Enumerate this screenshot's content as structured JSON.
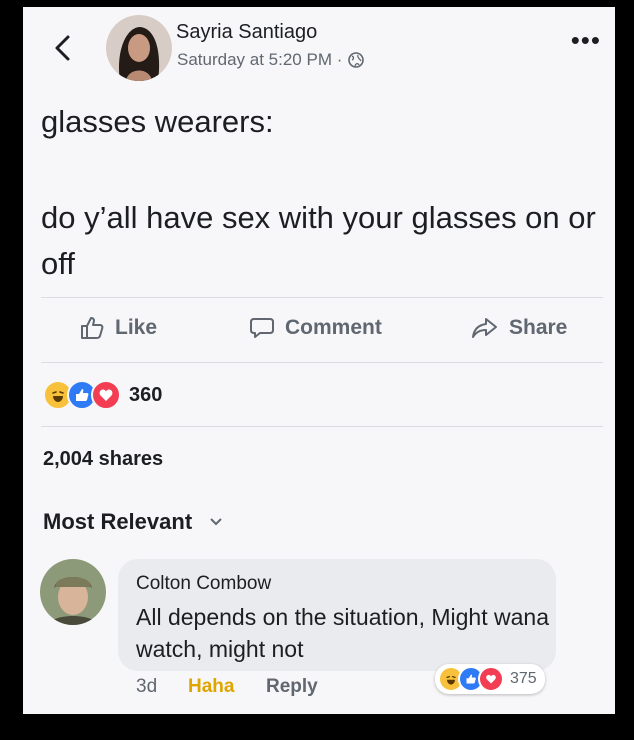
{
  "post": {
    "author": "Sayria Santiago",
    "timestamp": "Saturday at 5:20 PM ·",
    "text_line1": "glasses wearers:",
    "text_line2": "do y’all have sex with your glasses on or off"
  },
  "actions": {
    "like": "Like",
    "comment": "Comment",
    "share": "Share"
  },
  "reactions": {
    "count": "360",
    "types": [
      "haha-icon",
      "like-icon",
      "love-icon"
    ]
  },
  "shares": "2,004 shares",
  "sort": {
    "label": "Most Relevant"
  },
  "comment": {
    "author": "Colton Combow",
    "text": "All depends on the situation, Might wana watch, might not",
    "age": "3d",
    "reaction_label": "Haha",
    "reply_label": "Reply",
    "reaction_count": "375"
  },
  "colors": {
    "like_blue": "#2f7bf5",
    "love_red": "#f23d53",
    "haha_yellow": "#f7c13b",
    "haha_text": "#e0a500"
  }
}
